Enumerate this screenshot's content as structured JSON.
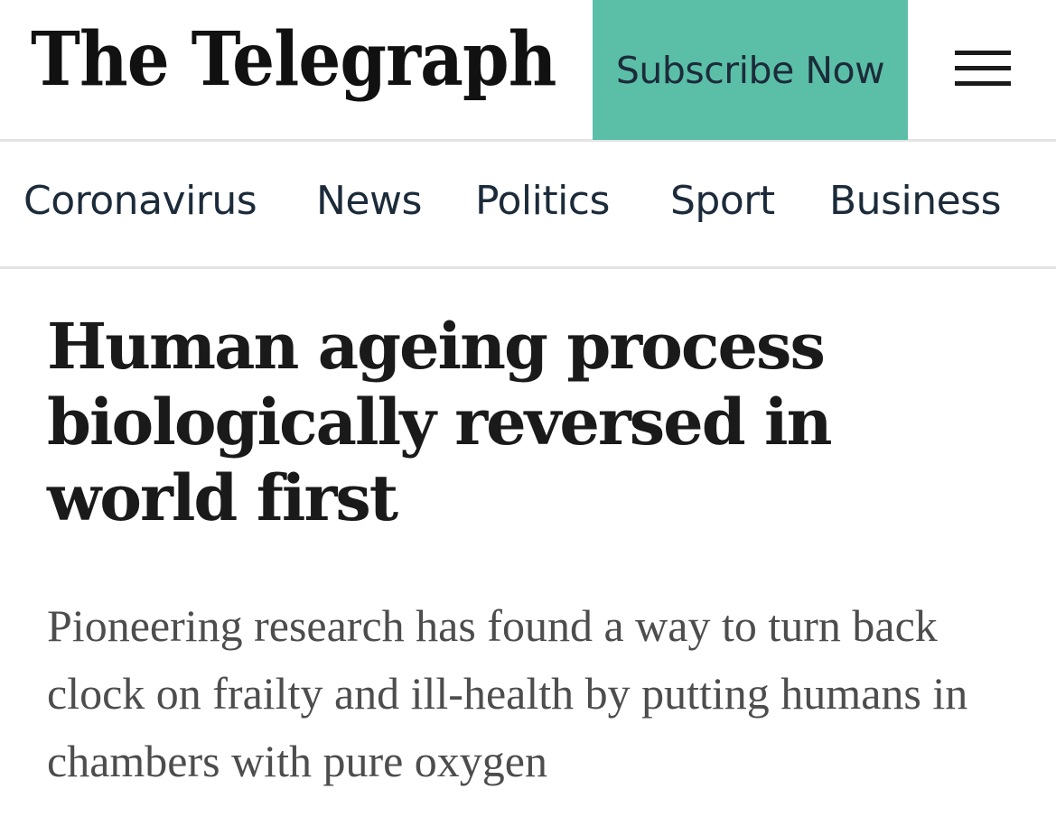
{
  "header": {
    "logo_text": "The Telegraph",
    "subscribe_label": "Subscribe Now",
    "menu_icon": "hamburger-menu-icon",
    "subscribe_color": "#5bbfa8"
  },
  "nav": {
    "items": [
      {
        "label": "Coronavirus"
      },
      {
        "label": "News"
      },
      {
        "label": "Politics"
      },
      {
        "label": "Sport"
      },
      {
        "label": "Business"
      }
    ]
  },
  "article": {
    "headline": "Human ageing process biologically reversed in world first",
    "standfirst": "Pioneering research has found a way to turn back clock on frailty and ill-health by putting humans in chambers with pure oxygen"
  }
}
